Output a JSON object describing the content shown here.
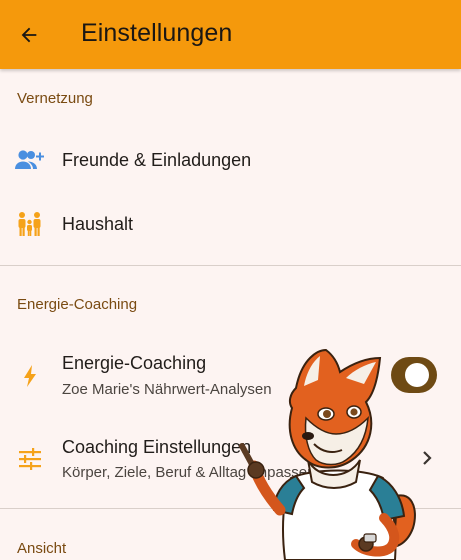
{
  "appbar": {
    "title": "Einstellungen"
  },
  "sections": {
    "network": {
      "header": "Vernetzung",
      "friends": {
        "label": "Freunde & Einladungen"
      },
      "household": {
        "label": "Haushalt"
      }
    },
    "coaching": {
      "header": "Energie-Coaching",
      "energy": {
        "label": "Energie-Coaching",
        "subtitle": "Zoe Marie's Nährwert-Analysen",
        "enabled": true
      },
      "settings": {
        "label": "Coaching Einstellungen",
        "subtitle": "Körper, Ziele, Beruf & Alltag anpassen"
      }
    },
    "view": {
      "header": "Ansicht"
    }
  },
  "colors": {
    "appbar": "#f5990c",
    "accent_icon": "#f5a21a",
    "friends_icon": "#4a8fe0",
    "toggle_on": "#6e4a14"
  },
  "icons": {
    "back": "arrow-left-icon",
    "friends": "person-add-icon",
    "household": "family-icon",
    "energy": "lightning-icon",
    "settings": "tune-icon",
    "navigate": "chevron-right-icon"
  }
}
